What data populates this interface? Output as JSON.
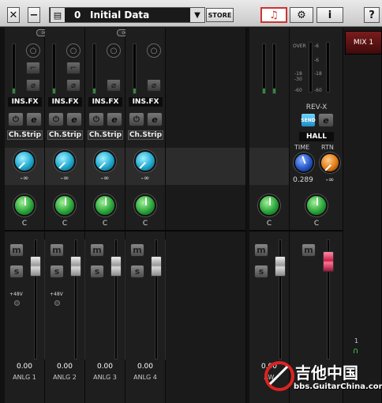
{
  "toolbar": {
    "close_glyph": "✕",
    "min_glyph": "−",
    "doc_glyph": "▤",
    "scene_number": "0",
    "scene_title": "Initial Data",
    "dropdown_glyph": "▼",
    "store_label": "STORE",
    "mixer_glyph": "♫",
    "settings_glyph": "⚙",
    "info_glyph": "i",
    "help_glyph": "?"
  },
  "channels": [
    {
      "ins_label": "INS.FX",
      "chstrip_label": "Ch.Strip",
      "send_value": "-∞",
      "pan_value": "C",
      "phantom": "+48V",
      "fader_value": "0.00",
      "name": "ANLG 1"
    },
    {
      "ins_label": "INS.FX",
      "chstrip_label": "Ch.Strip",
      "send_value": "-∞",
      "pan_value": "C",
      "phantom": "+48V",
      "fader_value": "0.00",
      "name": "ANLG 2"
    },
    {
      "ins_label": "INS.FX",
      "chstrip_label": "Ch.Strip",
      "send_value": "-∞",
      "pan_value": "C",
      "phantom": "",
      "fader_value": "0.00",
      "name": "ANLG 3"
    },
    {
      "ins_label": "INS.FX",
      "chstrip_label": "Ch.Strip",
      "send_value": "-∞",
      "pan_value": "C",
      "phantom": "",
      "fader_value": "0.00",
      "name": "ANLG 4"
    }
  ],
  "daw_channel": {
    "pan_value": "C",
    "fader_value": "0.00",
    "name": "AW"
  },
  "reverb": {
    "scale": [
      "OVER",
      "-6",
      "-18",
      "-30",
      "-60"
    ],
    "scale_left": [
      "-18"
    ],
    "title": "REV-X",
    "sends_label": "SEND",
    "type": "HALL",
    "time_label": "TIME",
    "rtn_label": "RTN",
    "time_value": "0.289",
    "rtn_value": "-∞",
    "pan_value": "C"
  },
  "mix": {
    "label": "MIX 1",
    "out_number": "1"
  },
  "watermark": {
    "title": "吉他中国",
    "url": "bbs.GuitarChina.com"
  },
  "glyphs": {
    "mute": "m",
    "solo": "s",
    "edit": "e",
    "power": "⏻",
    "phase": "⌀",
    "hpf": "⌐",
    "hi_z": "○"
  },
  "colors": {
    "send_knob": "#1fa8cf",
    "pan_knob": "#2aa43a",
    "time_knob": "#2456c8",
    "rtn_knob": "#e07a14",
    "reverb_fader": "#c7224a",
    "mix_tab": "#7a1c1c"
  }
}
